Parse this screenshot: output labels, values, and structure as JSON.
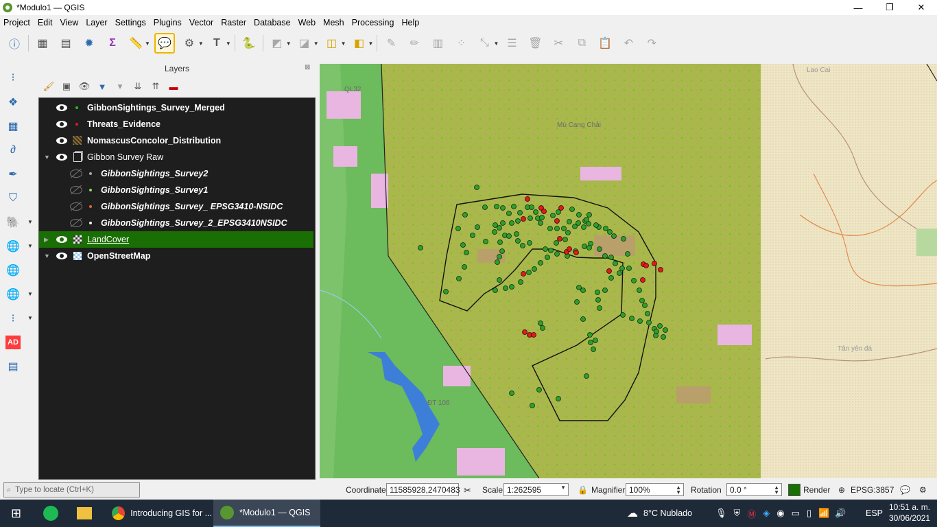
{
  "window": {
    "title": "*Modulo1 — QGIS",
    "controls": [
      "—",
      "❐",
      "✕"
    ]
  },
  "menu": [
    "Project",
    "Edit",
    "View",
    "Layer",
    "Settings",
    "Plugins",
    "Vector",
    "Raster",
    "Database",
    "Web",
    "Mesh",
    "Processing",
    "Help"
  ],
  "layers_panel": {
    "title": "Layers",
    "close": "⊠",
    "items": [
      {
        "name": "GibbonSightings_Survey_Merged",
        "visible": true,
        "symbol": "green-dot"
      },
      {
        "name": "Threats_Evidence",
        "visible": true,
        "symbol": "red-dot"
      },
      {
        "name": "NomascusConcolor_Distribution",
        "visible": true,
        "symbol": "polygon-hatch"
      },
      {
        "name": "Gibbon Survey Raw",
        "visible": true,
        "symbol": "group"
      },
      {
        "name": "GibbonSightings_Survey2",
        "visible": false,
        "symbol": "gray-dot"
      },
      {
        "name": "GibbonSightings_Survey1",
        "visible": false,
        "symbol": "lightgreen-dot"
      },
      {
        "name": "GibbonSightings_Survey_ EPSG3410-NSIDC",
        "visible": false,
        "symbol": "orange-dot"
      },
      {
        "name": "GibbonSightings_Survey_2_EPSG3410NSIDC",
        "visible": false,
        "symbol": "white-dot"
      },
      {
        "name": "LandCover",
        "visible": true,
        "symbol": "raster",
        "selected": true
      },
      {
        "name": "OpenStreetMap",
        "visible": true,
        "symbol": "xyz"
      }
    ]
  },
  "map_labels": {
    "road1": "QL32",
    "road2": "ĐT 106",
    "place1": "Mù Cang Chải",
    "place2": "Lao Cai",
    "place3": "Tân yên đá"
  },
  "status": {
    "locate_placeholder": "Type to locate (Ctrl+K)",
    "coordinate_label": "Coordinate",
    "coordinate_value": "11585928,2470483",
    "scale_label": "Scale",
    "scale_value": "1:262595",
    "magnifier_label": "Magnifier",
    "magnifier_value": "100%",
    "rotation_label": "Rotation",
    "rotation_value": "0.0 °",
    "render_label": "Render",
    "crs": "EPSG:3857"
  },
  "taskbar": {
    "tasks": [
      {
        "label": "Introducing GIS for ..."
      },
      {
        "label": "*Modulo1 — QGIS"
      }
    ],
    "weather": "8°C  Nublado",
    "lang": "ESP",
    "time": "10:51 a. m.",
    "date": "30/06/2021"
  },
  "colors": {
    "selected_layer": "#1a6f04",
    "gibbon_point": "#2e9e2e",
    "threat_point": "#e01b1b",
    "map_green": "#a6b84a",
    "water": "#3d7fd8"
  }
}
